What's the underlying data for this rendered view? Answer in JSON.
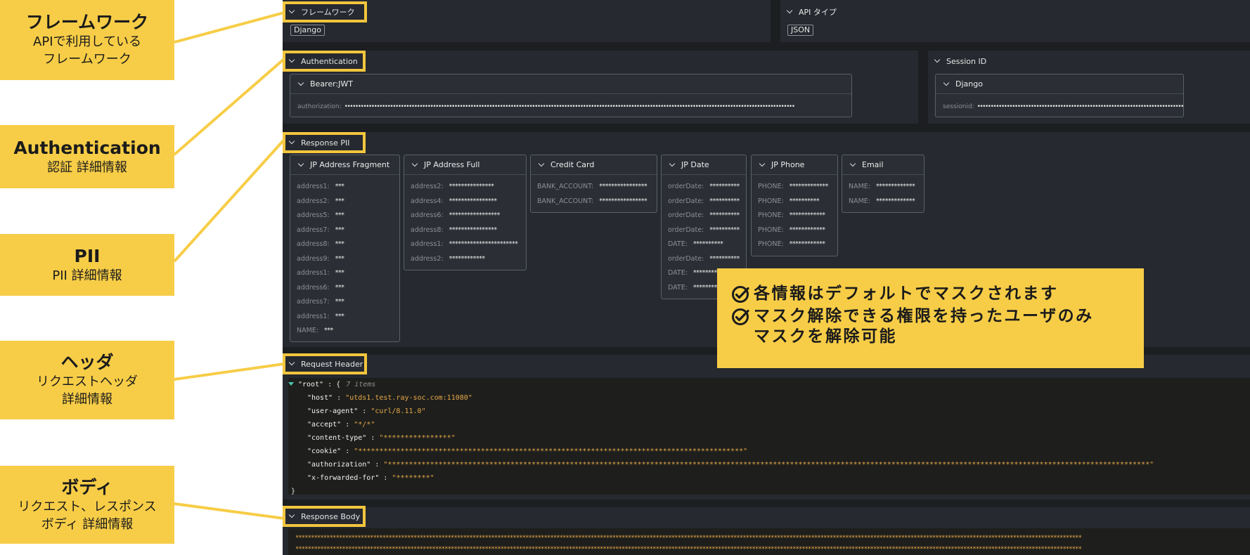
{
  "callouts": [
    {
      "title": "フレームワーク",
      "sub1": "APIで利用している",
      "sub2": "フレームワーク"
    },
    {
      "title": "Authentication",
      "sub1": "認証 詳細情報"
    },
    {
      "title": "PII",
      "sub1": "PII 詳細情報"
    },
    {
      "title": "ヘッダ",
      "sub1": "リクエストヘッダ",
      "sub2": "詳細情報"
    },
    {
      "title": "ボディ",
      "sub1": "リクエスト、レスポンス",
      "sub2": "ボディ 詳細情報"
    }
  ],
  "framework": {
    "label": "フレームワーク",
    "value": "Django"
  },
  "api_type": {
    "label": "API タイプ",
    "value": "JSON"
  },
  "authentication": {
    "label": "Authentication",
    "panel_title": "Bearer:JWT",
    "key": "authorization:",
    "value": "••••••••••••••••••••••••••••••••••••••••••••••••••••••••••••••••••••••••••••••••••••••••••••••••••••••••••••••••••••••••••••••••••••••••••••••••••••••••••••••••••••••••"
  },
  "session": {
    "label": "Session ID",
    "panel_title": "Django",
    "key": "sessionid:",
    "value": "••••••••••••••••••••••••••••••••••••••••••••••••••••••••••••••••••••••••••••••••••••••••••••••••••"
  },
  "response_pii": {
    "label": "Response PII",
    "panels": [
      {
        "title": "JP Address Fragment",
        "rows": [
          {
            "k": "address1:",
            "v": "***"
          },
          {
            "k": "address2:",
            "v": "***"
          },
          {
            "k": "address5:",
            "v": "***"
          },
          {
            "k": "address7:",
            "v": "***"
          },
          {
            "k": "address8:",
            "v": "***"
          },
          {
            "k": "address9:",
            "v": "***"
          },
          {
            "k": "address1:",
            "v": "***"
          },
          {
            "k": "address6:",
            "v": "***"
          },
          {
            "k": "address7:",
            "v": "***"
          },
          {
            "k": "address1:",
            "v": "***"
          },
          {
            "k": "NAME:",
            "v": "***"
          }
        ]
      },
      {
        "title": "JP Address Full",
        "rows": [
          {
            "k": "address2:",
            "v": "***************"
          },
          {
            "k": "address4:",
            "v": "****************"
          },
          {
            "k": "address6:",
            "v": "*****************"
          },
          {
            "k": "address8:",
            "v": "****************"
          },
          {
            "k": "address1:",
            "v": "***********************"
          },
          {
            "k": "address2:",
            "v": "************"
          }
        ]
      },
      {
        "title": "Credit Card",
        "rows": [
          {
            "k": "BANK_ACCOUNT:",
            "v": "****************"
          },
          {
            "k": "BANK_ACCOUNT:",
            "v": "****************"
          }
        ]
      },
      {
        "title": "JP Date",
        "rows": [
          {
            "k": "orderDate:",
            "v": "**********"
          },
          {
            "k": "orderDate:",
            "v": "**********"
          },
          {
            "k": "orderDate:",
            "v": "**********"
          },
          {
            "k": "orderDate:",
            "v": "**********"
          },
          {
            "k": "DATE:",
            "v": "**********"
          },
          {
            "k": "orderDate:",
            "v": "**********"
          },
          {
            "k": "DATE:",
            "v": "**********"
          },
          {
            "k": "DATE:",
            "v": "**********"
          }
        ]
      },
      {
        "title": "JP Phone",
        "rows": [
          {
            "k": "PHONE:",
            "v": "*************"
          },
          {
            "k": "PHONE:",
            "v": "**********"
          },
          {
            "k": "PHONE:",
            "v": "************"
          },
          {
            "k": "PHONE:",
            "v": "************"
          },
          {
            "k": "PHONE:",
            "v": "************"
          }
        ]
      },
      {
        "title": "Email",
        "rows": [
          {
            "k": "NAME:",
            "v": "*************"
          },
          {
            "k": "NAME:",
            "v": "*************"
          }
        ]
      }
    ]
  },
  "request_header": {
    "label": "Request Header",
    "root_key": "\"root\"",
    "root_open": " : {",
    "count": "7 items",
    "entries": [
      {
        "k": "\"host\"",
        "v": "\"utds1.test.ray-soc.com:11080\""
      },
      {
        "k": "\"user-agent\"",
        "v": "\"curl/8.11.0\""
      },
      {
        "k": "\"accept\"",
        "v": "\"*/*\""
      },
      {
        "k": "\"content-type\"",
        "v": "\"****************\""
      },
      {
        "k": "\"cookie\"",
        "v": "\"*******************************************************************************************\""
      },
      {
        "k": "\"authorization\"",
        "v": "\"************************************************************************************************************************************************************************************\""
      },
      {
        "k": "\"x-forwarded-for\"",
        "v": "\"********\""
      }
    ],
    "close": "}"
  },
  "response_body": {
    "label": "Response Body",
    "lines": [
      "*************************************************************************************************************************************************************************************************************************************************************",
      "*************************************************************************************************************************************************************************************************************************************************************"
    ]
  },
  "overlay": {
    "line1": "各情報はデフォルトでマスクされます",
    "line2": "マスク解除できる権限を持ったユーザのみ",
    "line3": "マスクを解除可能"
  },
  "colors": {
    "accent": "#f7cd47",
    "highlight_border": "#f2c53d",
    "background": "#1c1e22",
    "json_value": "#e6a74a"
  }
}
